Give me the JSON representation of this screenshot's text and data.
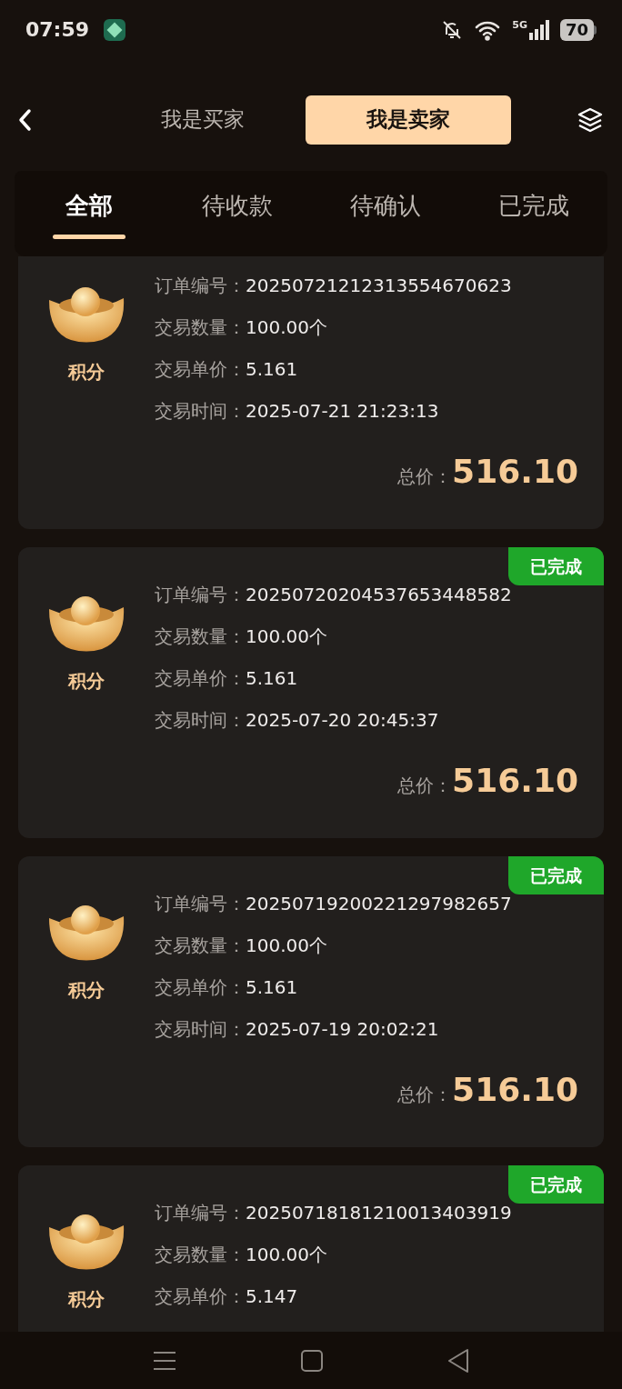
{
  "status_bar": {
    "time": "07:59",
    "network": "5G",
    "battery": "70"
  },
  "role_switch": [
    {
      "label": "我是买家",
      "selected": false
    },
    {
      "label": "我是卖家",
      "selected": true
    }
  ],
  "tabs": [
    {
      "label": "全部",
      "selected": true
    },
    {
      "label": "待收款",
      "selected": false
    },
    {
      "label": "待确认",
      "selected": false
    },
    {
      "label": "已完成",
      "selected": false
    }
  ],
  "orders": [
    {
      "product": "积分",
      "fields": [
        {
          "label": "订单编号：",
          "value": "20250721212313554670623"
        },
        {
          "label": "交易数量：",
          "value": "100.00个"
        },
        {
          "label": "交易单价：",
          "value": "5.161"
        },
        {
          "label": "交易时间：",
          "value": "2025-07-21 21:23:13"
        }
      ],
      "total_label": "总价：",
      "total": "516.10"
    },
    {
      "status": "已完成",
      "product": "积分",
      "fields": [
        {
          "label": "订单编号：",
          "value": "20250720204537653448582"
        },
        {
          "label": "交易数量：",
          "value": "100.00个"
        },
        {
          "label": "交易单价：",
          "value": "5.161"
        },
        {
          "label": "交易时间：",
          "value": "2025-07-20 20:45:37"
        }
      ],
      "total_label": "总价：",
      "total": "516.10"
    },
    {
      "status": "已完成",
      "product": "积分",
      "fields": [
        {
          "label": "订单编号：",
          "value": "20250719200221297982657"
        },
        {
          "label": "交易数量：",
          "value": "100.00个"
        },
        {
          "label": "交易单价：",
          "value": "5.161"
        },
        {
          "label": "交易时间：",
          "value": "2025-07-19 20:02:21"
        }
      ],
      "total_label": "总价：",
      "total": "516.10"
    },
    {
      "status": "已完成",
      "product": "积分",
      "fields": [
        {
          "label": "订单编号：",
          "value": "20250718181210013403919"
        },
        {
          "label": "交易数量：",
          "value": "100.00个"
        },
        {
          "label": "交易单价：",
          "value": "5.147"
        }
      ]
    }
  ]
}
